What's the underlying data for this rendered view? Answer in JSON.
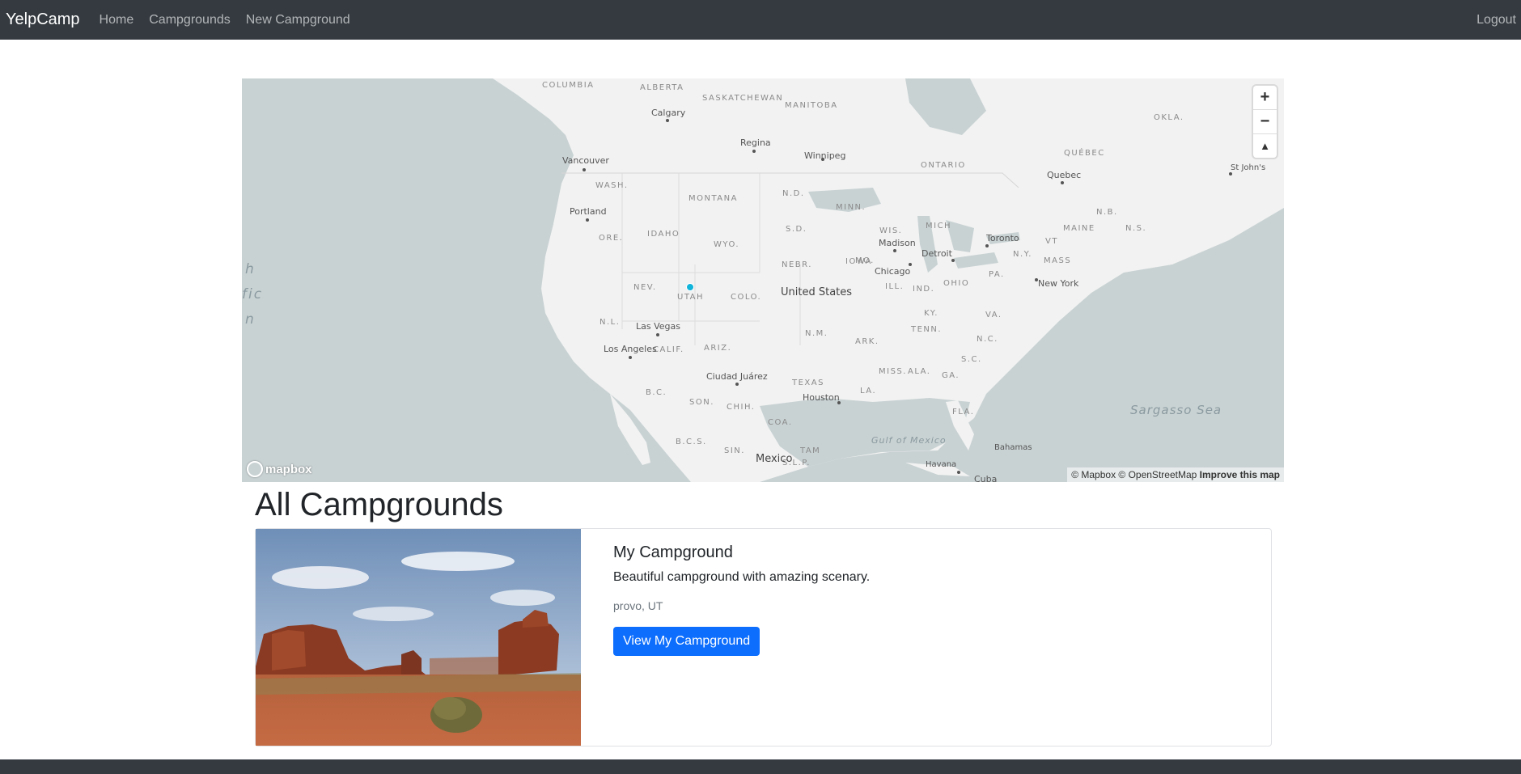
{
  "navbar": {
    "brand": "YelpCamp",
    "links": [
      "Home",
      "Campgrounds",
      "New Campground"
    ],
    "logout": "Logout"
  },
  "map": {
    "ocean_partial": [
      "h",
      "fic",
      "n"
    ],
    "states": [
      "ALBERTA",
      "SASKATCHEWAN",
      "MANITOBA",
      "ONTARIO",
      "QUÉBEC",
      "WASH.",
      "MONTANA",
      "N.D.",
      "MINN.",
      "WIS.",
      "MICH",
      "IDAHO",
      "WYO.",
      "S.D.",
      "ORE.",
      "NEBR.",
      "IOWA",
      "NEV.",
      "UTAH",
      "COLO.",
      "ILL.",
      "IND.",
      "OHIO",
      "PA.",
      "N.Y.",
      "MASS",
      "MAINE",
      "N.B.",
      "N.S.",
      "N.L.",
      "CALIF.",
      "ARIZ.",
      "N.M.",
      "OKLA.",
      "ARK.",
      "TENN.",
      "KY.",
      "VA.",
      "N.C.",
      "S.C.",
      "GA.",
      "ALA.",
      "MISS.",
      "LA.",
      "TEXAS",
      "FLA.",
      "MO.",
      "COLUMBIA",
      "SON.",
      "CHIH.",
      "COA.",
      "SIN.",
      "TAM",
      "S.L.P.",
      "B.C.",
      "B.C.S.",
      "VT"
    ],
    "cities": [
      "Calgary",
      "Regina",
      "Winnipeg",
      "Vancouver",
      "Portland",
      "Madison",
      "Detroit",
      "Toronto",
      "Chicago",
      "Quebec",
      "St John's",
      "New York",
      "Las Vegas",
      "Los Angeles",
      "Ciudad Juárez",
      "Houston",
      "Havana",
      "Bahamas",
      "Cuba"
    ],
    "country": "United States",
    "mexico": "Mexico",
    "water": [
      "Gulf of Mexico",
      "Sargasso Sea"
    ],
    "controls": {
      "zoom_in": "+",
      "zoom_out": "−",
      "compass": "▲"
    },
    "attribution": {
      "text": "© Mapbox © OpenStreetMap",
      "improve": "Improve this map"
    },
    "logo": "mapbox",
    "marker_color": "#11b4da"
  },
  "page": {
    "heading": "All Campgrounds"
  },
  "campgrounds": [
    {
      "title": "My Campground",
      "description": "Beautiful campground with amazing scenary.",
      "location": "provo, UT",
      "button": "View My Campground"
    }
  ],
  "colors": {
    "navbar": "#343a40",
    "primary": "#0d6efd"
  }
}
